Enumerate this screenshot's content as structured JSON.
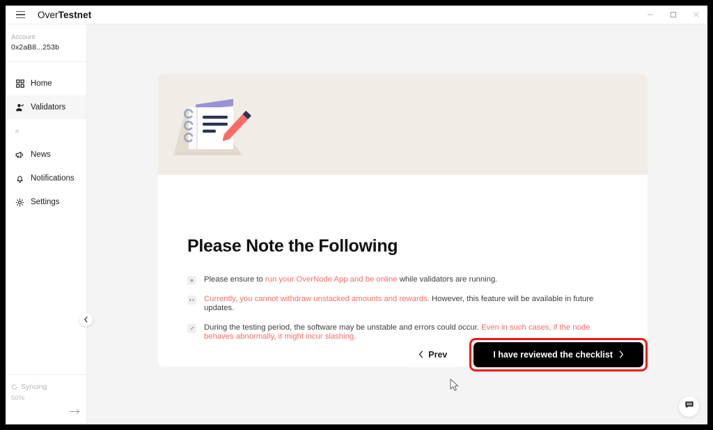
{
  "window": {
    "title_light": "Over",
    "title_bold": "Testnet",
    "controls": {
      "minimize": "minimize-icon",
      "maximize": "maximize-icon",
      "close": "close-icon"
    },
    "menu_icon": "hamburger-icon"
  },
  "sidebar": {
    "account_label": "Account",
    "account_address": "0x2aB8...253b",
    "items": [
      {
        "label": "Home",
        "icon": "grid-icon",
        "active": false
      },
      {
        "label": "Validators",
        "icon": "user-check-icon",
        "active": true
      },
      {
        "label": "News",
        "icon": "megaphone-icon",
        "active": false
      },
      {
        "label": "Notifications",
        "icon": "bell-icon",
        "active": false
      },
      {
        "label": "Settings",
        "icon": "gear-icon",
        "active": false
      }
    ],
    "status": {
      "sync_label": "Syncing",
      "sync_percent": "50%",
      "sync_icon": "spinner-icon",
      "arrow_icon": "arrow-right-icon"
    },
    "collapse_icon": "chevron-left-icon"
  },
  "main": {
    "banner_icon": "notebook-pencil-illustration",
    "banner_color": "#f2ece6",
    "title": "Please Note the Following",
    "notes": [
      {
        "icon": "info-badge-icon",
        "segments": [
          {
            "text": "Please ensure to ",
            "highlight": false
          },
          {
            "text": "run your OverNode App and be online",
            "highlight": true
          },
          {
            "text": " while validators are running.",
            "highlight": false
          }
        ]
      },
      {
        "icon": "pause-badge-icon",
        "segments": [
          {
            "text": "Currently, you cannot withdraw unstacked amounts and rewards.",
            "highlight": true
          },
          {
            "text": " However, this feature will be available in future updates.",
            "highlight": false
          }
        ]
      },
      {
        "icon": "expand-badge-icon",
        "segments": [
          {
            "text": "During the testing period, the software may be unstable and errors could occur. ",
            "highlight": false
          },
          {
            "text": "Even in such cases, if the node behaves abnormally, it might incur slashing.",
            "highlight": true
          }
        ]
      }
    ],
    "footer": {
      "prev_label": "Prev",
      "prev_icon": "chevron-left-icon",
      "primary_label": "I have reviewed the checklist",
      "primary_icon": "chevron-right-icon",
      "primary_highlight_color": "#ff1111"
    },
    "chat_icon": "chat-bubble-icon",
    "cursor_icon": "mouse-pointer-icon"
  },
  "theme": {
    "accent_red": "#fa6b63",
    "background": "#f4f4f4",
    "panel": "#ffffff",
    "text": "#1b1b1b"
  }
}
